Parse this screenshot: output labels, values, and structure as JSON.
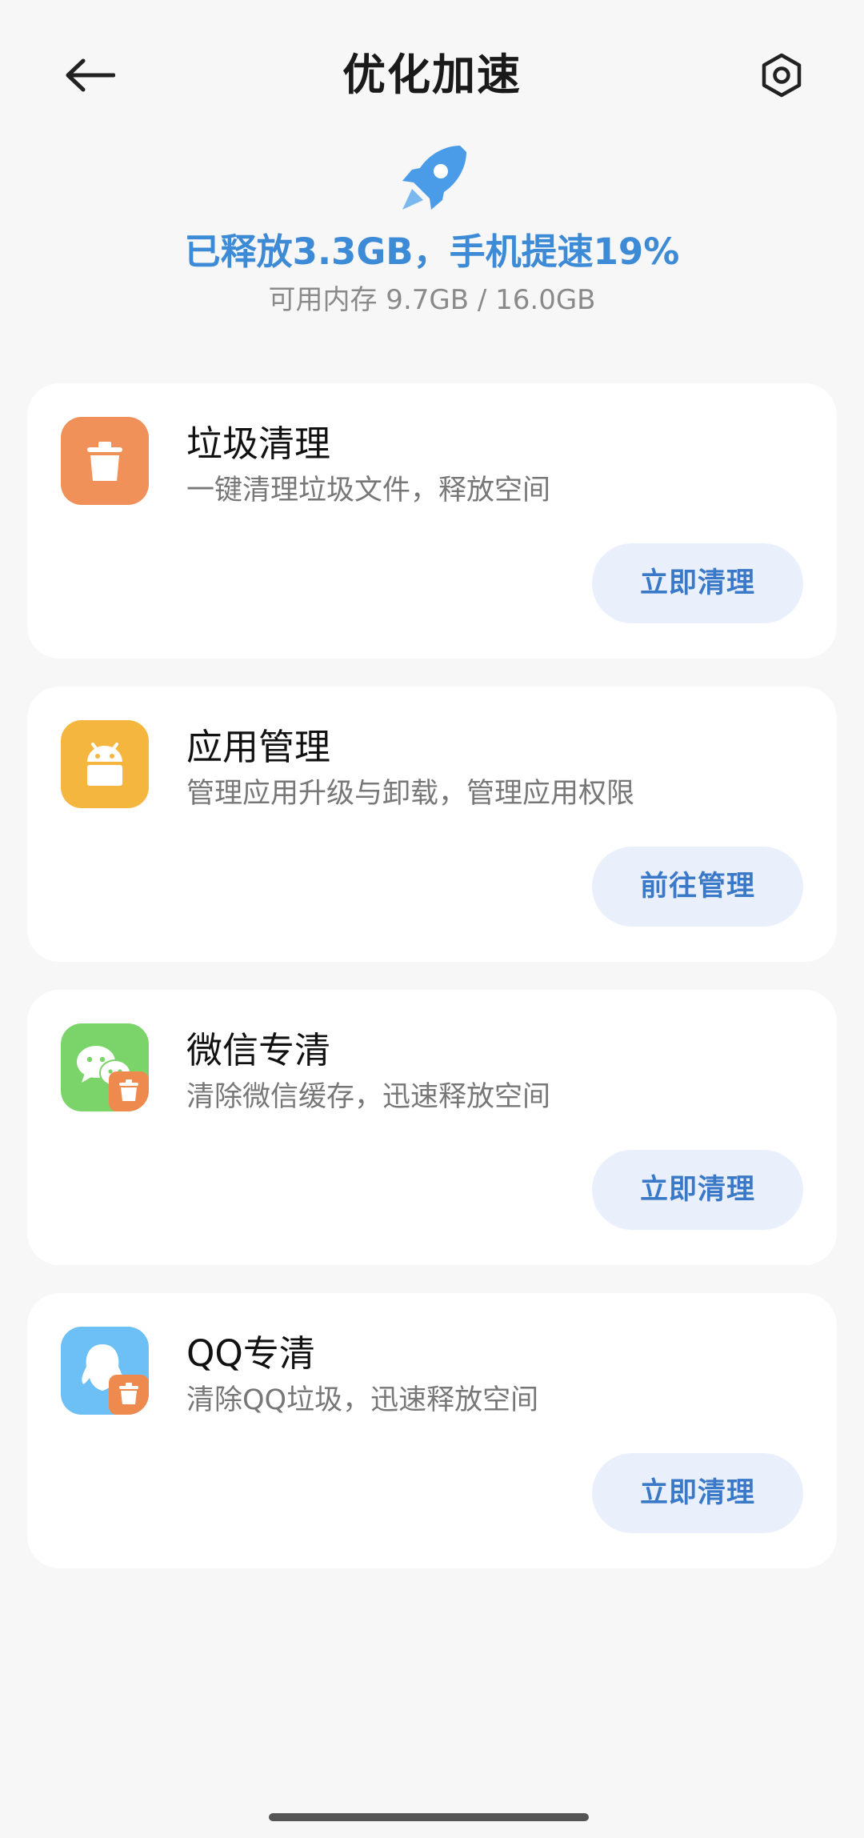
{
  "header": {
    "title": "优化加速",
    "back_icon": "arrow-left-icon",
    "settings_icon": "gear-icon"
  },
  "summary": {
    "icon": "rocket-icon",
    "headline": "已释放3.3GB，手机提速19%",
    "memory": "可用内存 9.7GB / 16.0GB",
    "accent_color": "#3d8bd6"
  },
  "cards": [
    {
      "title": "垃圾清理",
      "desc": "一键清理垃圾文件，释放空间",
      "button": "立即清理",
      "icon": "trash-can-icon",
      "icon_color": "#f0915a"
    },
    {
      "title": "应用管理",
      "desc": "管理应用升级与卸载，管理应用权限",
      "button": "前往管理",
      "icon": "android-box-icon",
      "icon_color": "#f5b63f"
    },
    {
      "title": "微信专清",
      "desc": "清除微信缓存，迅速释放空间",
      "button": "立即清理",
      "icon": "wechat-clean-icon",
      "icon_color": "#7bd46a"
    },
    {
      "title": "QQ专清",
      "desc": "清除QQ垃圾，迅速释放空间",
      "button": "立即清理",
      "icon": "qq-clean-icon",
      "icon_color": "#6cc0f5"
    }
  ]
}
